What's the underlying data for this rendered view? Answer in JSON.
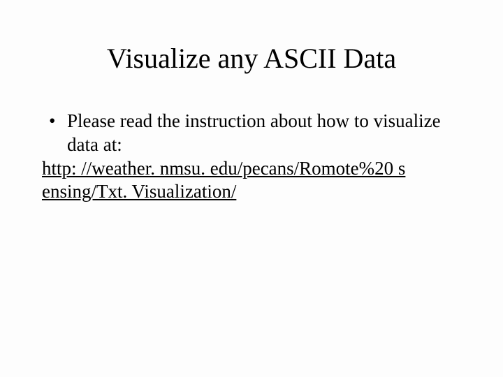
{
  "slide": {
    "title": "Visualize any ASCII Data",
    "bullet_text": "Please read the instruction about how to visualize data at:",
    "link_text": "http: //weather. nmsu. edu/pecans/Romote%20 s ensing/Txt. Visualization/"
  }
}
